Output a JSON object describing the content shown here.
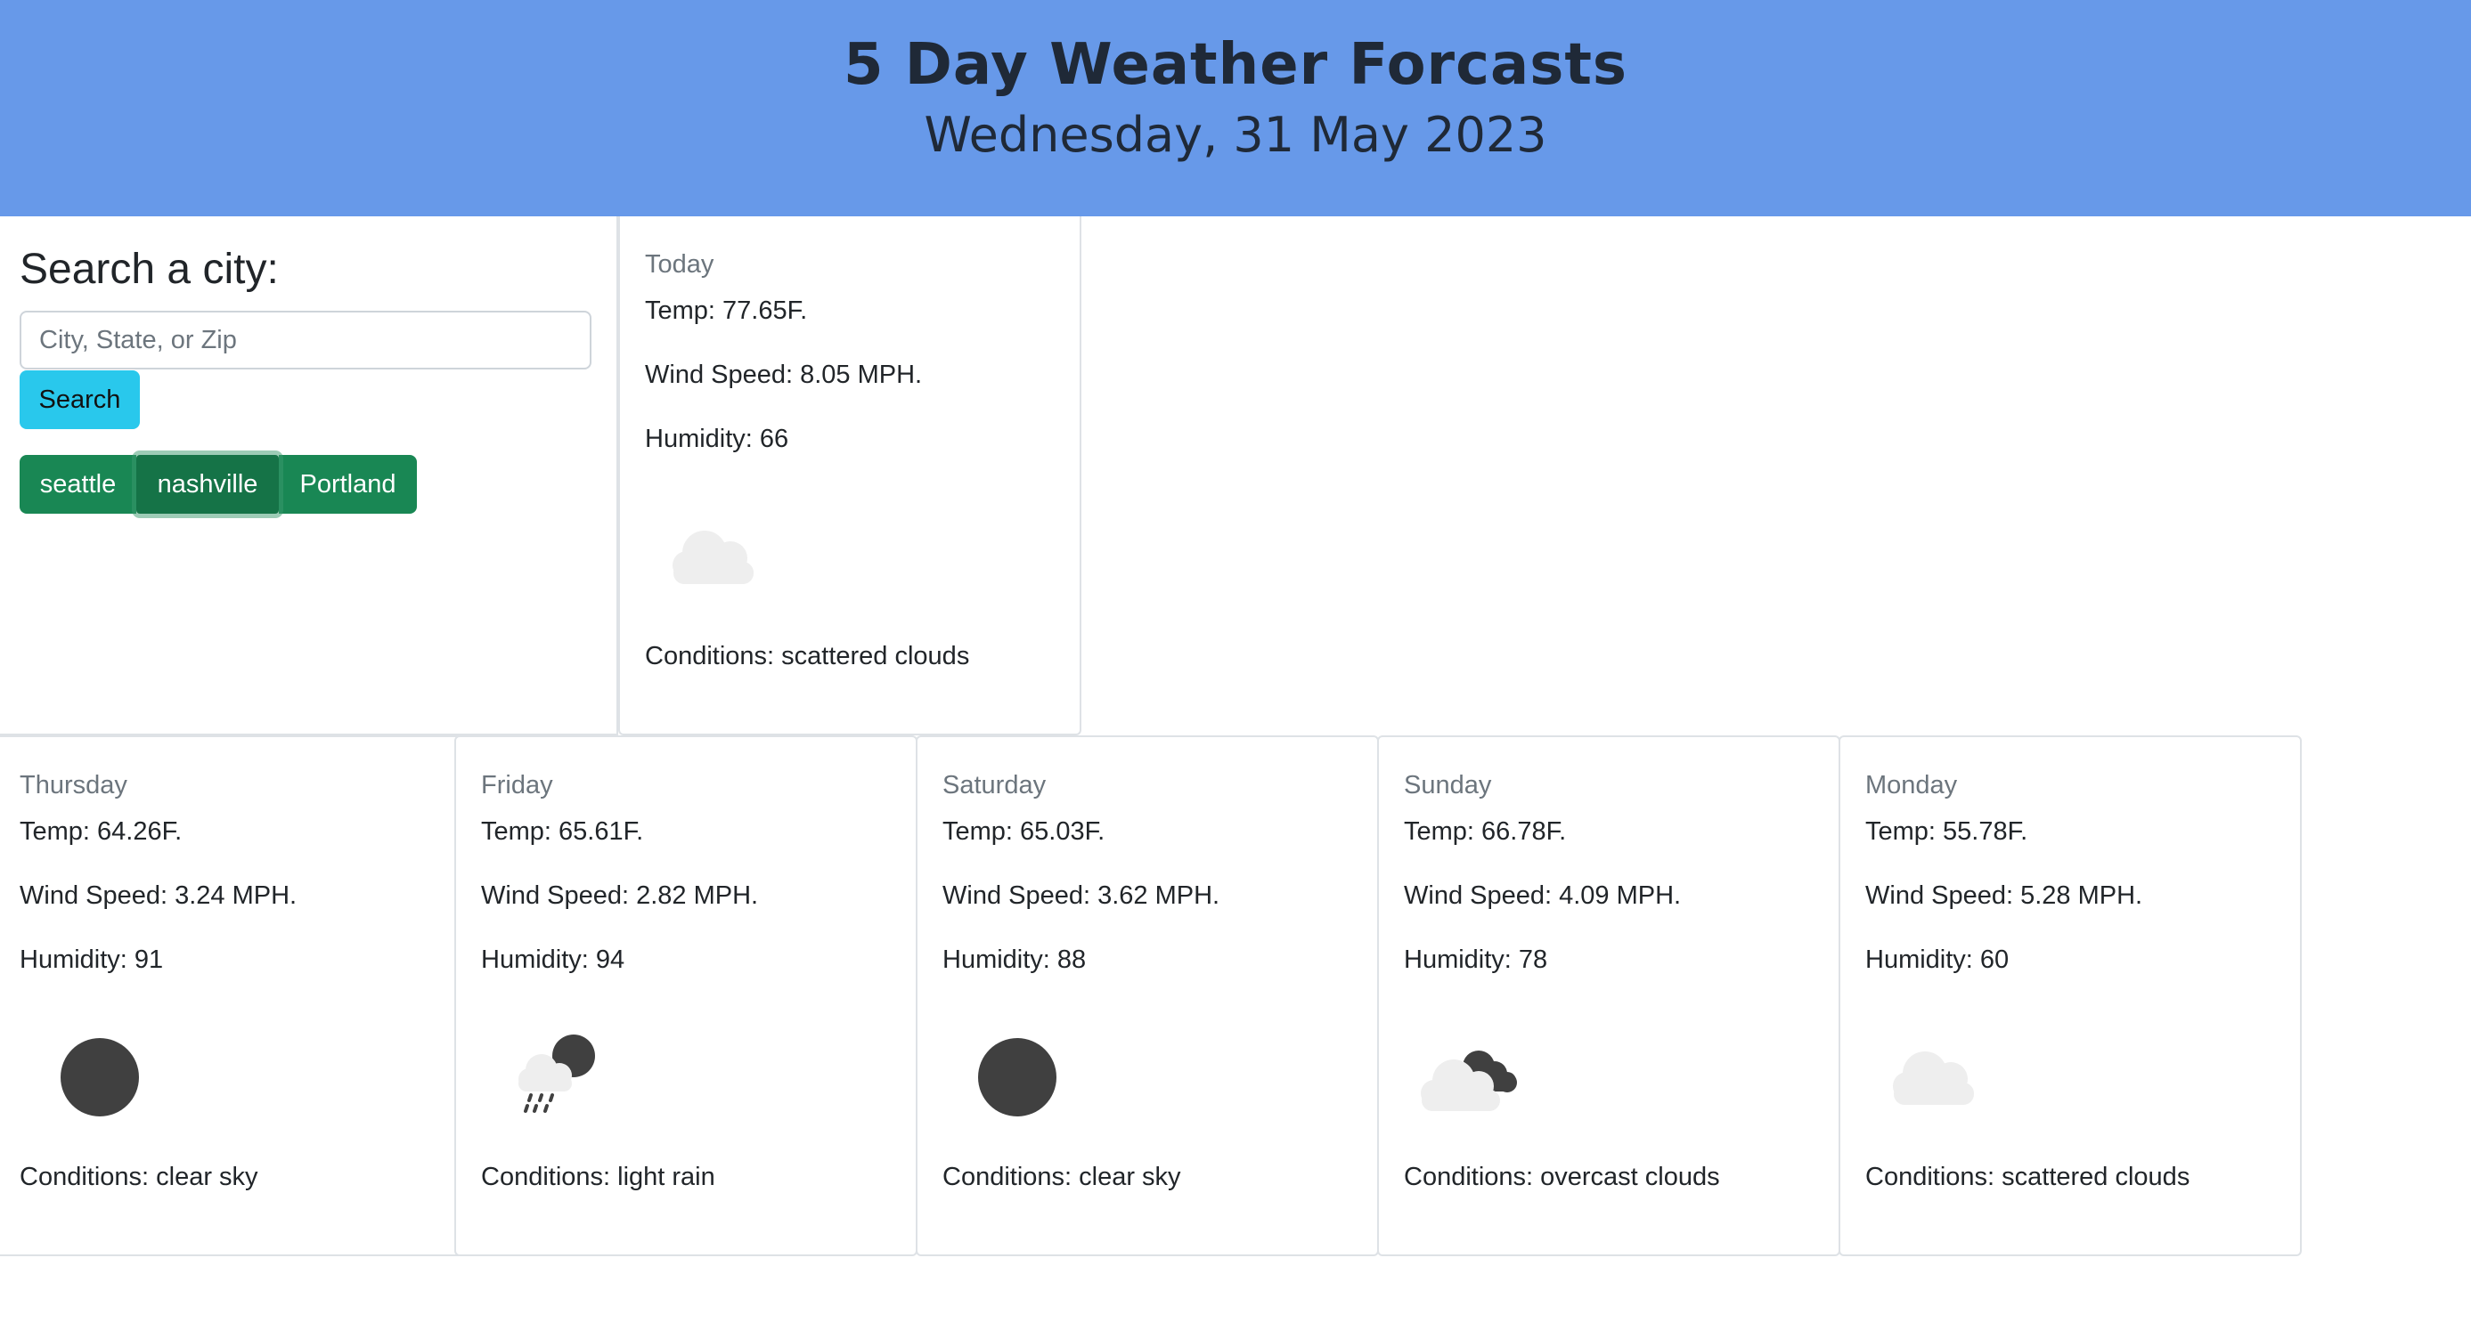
{
  "header": {
    "title": "5 Day Weather Forcasts",
    "date": "Wednesday, 31 May 2023",
    "background": "#6799e9"
  },
  "search": {
    "title": "Search a city:",
    "placeholder": "City, State, or Zip",
    "value": "",
    "button_label": "Search",
    "history": [
      "seattle",
      "nashville",
      "Portland"
    ]
  },
  "today": {
    "day": "Today",
    "temp": "Temp: 77.65F.",
    "wind": "Wind Speed: 8.05 MPH.",
    "humidity": "Humidity: 66",
    "icon": "scattered-clouds-icon",
    "conditions": "Conditions: scattered clouds"
  },
  "forecast": [
    {
      "day": "Thursday",
      "temp": "Temp: 64.26F.",
      "wind": "Wind Speed: 3.24 MPH.",
      "humidity": "Humidity: 91",
      "icon": "clear-sky-night-icon",
      "conditions": "Conditions: clear sky"
    },
    {
      "day": "Friday",
      "temp": "Temp: 65.61F.",
      "wind": "Wind Speed: 2.82 MPH.",
      "humidity": "Humidity: 94",
      "icon": "light-rain-night-icon",
      "conditions": "Conditions: light rain"
    },
    {
      "day": "Saturday",
      "temp": "Temp: 65.03F.",
      "wind": "Wind Speed: 3.62 MPH.",
      "humidity": "Humidity: 88",
      "icon": "clear-sky-night-icon",
      "conditions": "Conditions: clear sky"
    },
    {
      "day": "Sunday",
      "temp": "Temp: 66.78F.",
      "wind": "Wind Speed: 4.09 MPH.",
      "humidity": "Humidity: 78",
      "icon": "overcast-clouds-icon",
      "conditions": "Conditions: overcast clouds"
    },
    {
      "day": "Monday",
      "temp": "Temp: 55.78F.",
      "wind": "Wind Speed: 5.28 MPH.",
      "humidity": "Humidity: 60",
      "icon": "scattered-clouds-icon",
      "conditions": "Conditions: scattered clouds"
    }
  ]
}
